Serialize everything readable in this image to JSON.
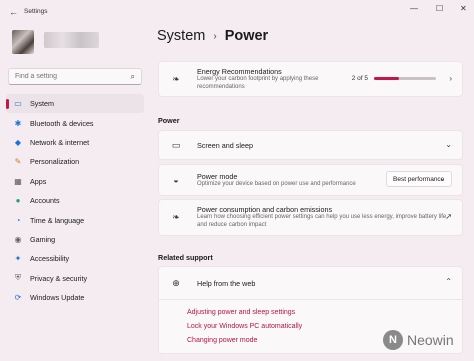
{
  "window": {
    "title": "Settings",
    "controls": [
      "—",
      "☐",
      "✕"
    ]
  },
  "search": {
    "placeholder": "Find a setting"
  },
  "breadcrumb": {
    "parent": "System",
    "separator": "›",
    "current": "Power"
  },
  "nav": {
    "items": [
      {
        "label": "System",
        "icon": "system-icon",
        "glyph": "▭",
        "color": "#2f6fd6"
      },
      {
        "label": "Bluetooth & devices",
        "icon": "bluetooth-icon",
        "glyph": "✱",
        "color": "#1a73d9"
      },
      {
        "label": "Network & internet",
        "icon": "network-icon",
        "glyph": "◆",
        "color": "#1a73d9"
      },
      {
        "label": "Personalization",
        "icon": "personalization-icon",
        "glyph": "✎",
        "color": "#d1792a"
      },
      {
        "label": "Apps",
        "icon": "apps-icon",
        "glyph": "▦",
        "color": "#555555"
      },
      {
        "label": "Accounts",
        "icon": "accounts-icon",
        "glyph": "●",
        "color": "#28a06a"
      },
      {
        "label": "Time & language",
        "icon": "time-language-icon",
        "glyph": "◔",
        "color": "#1a73d9"
      },
      {
        "label": "Gaming",
        "icon": "gaming-icon",
        "glyph": "◉",
        "color": "#666666"
      },
      {
        "label": "Accessibility",
        "icon": "accessibility-icon",
        "glyph": "✦",
        "color": "#1a73d9"
      },
      {
        "label": "Privacy & security",
        "icon": "privacy-icon",
        "glyph": "⛨",
        "color": "#666666"
      },
      {
        "label": "Windows Update",
        "icon": "windows-update-icon",
        "glyph": "⟳",
        "color": "#1a73d9"
      }
    ]
  },
  "energy": {
    "title": "Energy Recommendations",
    "subtitle_line1": "Lower your carbon footprint by applying these",
    "subtitle_line2": "recommendations",
    "progress_text": "2 of 5",
    "progress_fraction": 0.4
  },
  "power_section": {
    "label": "Power",
    "screen_sleep": {
      "title": "Screen and sleep"
    },
    "power_mode": {
      "title": "Power mode",
      "subtitle": "Optimize your device based on power use and performance",
      "selected": "Best performance"
    },
    "consumption": {
      "title": "Power consumption and carbon emissions",
      "subtitle_line1": "Learn how choosing efficient power settings can help you use less energy, improve battery life,",
      "subtitle_line2": "and reduce carbon impact"
    }
  },
  "related": {
    "label": "Related support",
    "help": {
      "title": "Help from the web"
    },
    "links": [
      "Adjusting power and sleep settings",
      "Lock your Windows PC automatically",
      "Changing power mode"
    ]
  },
  "watermark": {
    "text": "Neowin",
    "logo_letter": "N"
  },
  "colors": {
    "accent": "#c4164c",
    "link": "#b2173e",
    "background": "#f4ecf1"
  }
}
